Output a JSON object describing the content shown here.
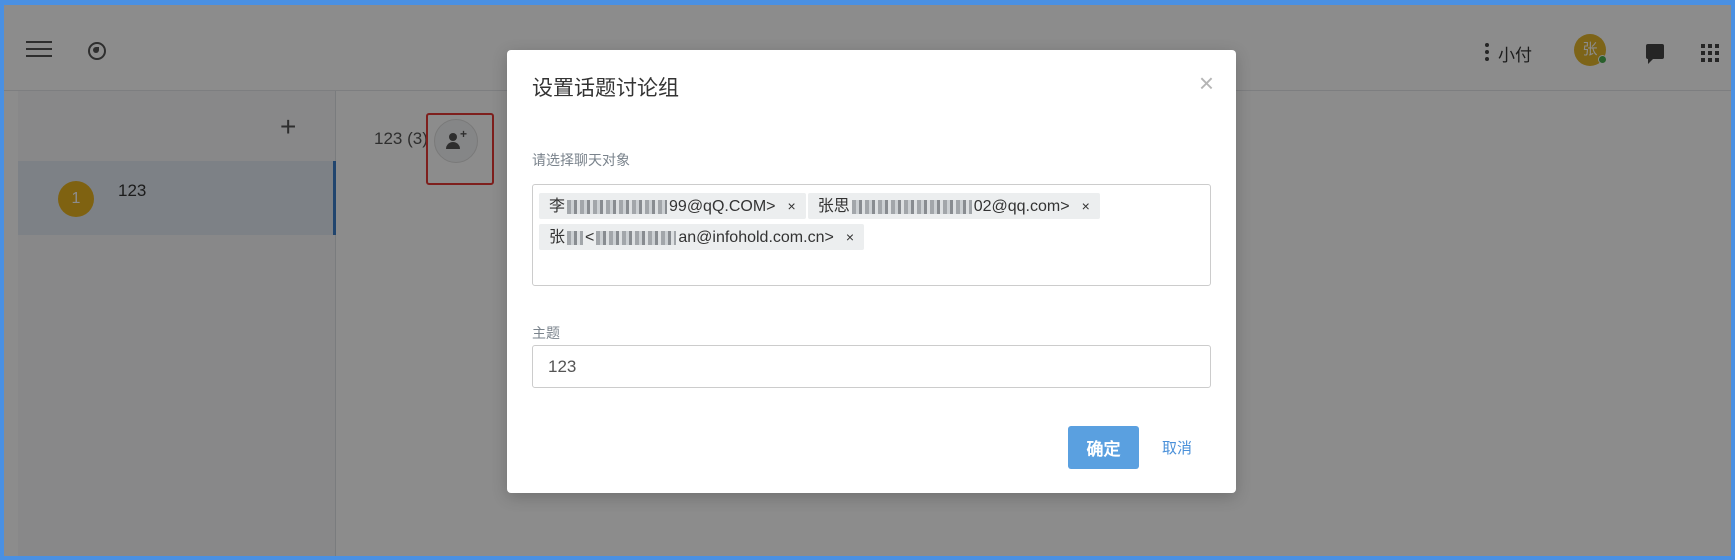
{
  "header": {
    "user_name": "小付",
    "avatar_text": "张",
    "status_color": "#4caf50"
  },
  "sidebar": {
    "add_label": "+",
    "chats": [
      {
        "avatar": "1",
        "name": "123"
      }
    ]
  },
  "conversation": {
    "title": "123 (3)"
  },
  "dialog": {
    "title": "设置话题讨论组",
    "close_label": "×",
    "recipients_label": "请选择聊天对象",
    "recipients": [
      {
        "prefix": "李",
        "suffix": "99@qQ.COM>",
        "remove": "×"
      },
      {
        "prefix": "张思",
        "suffix": "02@qq.com>",
        "remove": "×"
      },
      {
        "prefix": "张",
        "mid": "<",
        "suffix": "an@infohold.com.cn>",
        "remove": "×"
      }
    ],
    "subject_label": "主题",
    "subject_value": "123",
    "confirm_label": "确定",
    "cancel_label": "取消"
  },
  "colors": {
    "accent": "#5aa0e0",
    "highlight": "#e53935",
    "avatar_yellow": "#e8b21f"
  }
}
